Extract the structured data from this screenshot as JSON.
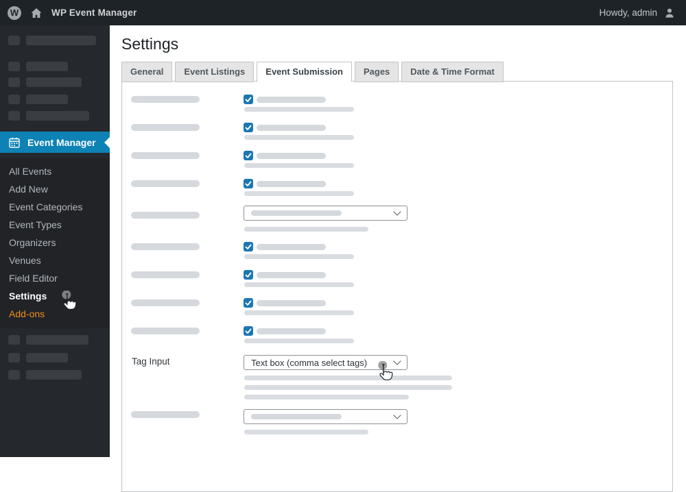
{
  "admin_bar": {
    "site_name": "WP Event Manager",
    "user_greeting": "Howdy, admin"
  },
  "sidebar": {
    "active_menu": {
      "label": "Event Manager"
    },
    "submenu": [
      {
        "label": "All Events",
        "state": "normal"
      },
      {
        "label": "Add New",
        "state": "normal"
      },
      {
        "label": "Event Categories",
        "state": "normal"
      },
      {
        "label": "Event Types",
        "state": "normal"
      },
      {
        "label": "Organizers",
        "state": "normal"
      },
      {
        "label": "Venues",
        "state": "normal"
      },
      {
        "label": "Field Editor",
        "state": "normal"
      },
      {
        "label": "Settings",
        "state": "current"
      },
      {
        "label": "Add-ons",
        "state": "orange"
      }
    ]
  },
  "main": {
    "title": "Settings",
    "tabs": [
      {
        "label": "General",
        "active": false
      },
      {
        "label": "Event Listings",
        "active": false
      },
      {
        "label": "Event Submission",
        "active": true
      },
      {
        "label": "Pages",
        "active": false
      },
      {
        "label": "Date & Time Format",
        "active": false
      }
    ],
    "form": {
      "checked_checkbox_count": 8,
      "tag_input": {
        "label": "Tag Input",
        "value": "Text box (comma select tags)"
      }
    }
  },
  "icons": {
    "check": "checkmark",
    "chevron_down": "chevron-down",
    "calendar": "calendar",
    "wordpress_logo": "W",
    "home": "home",
    "user": "person"
  },
  "colors": {
    "admin_bar_bg": "#1d2327",
    "sidebar_bg": "#25282c",
    "menu_highlight_blue": "#0e82b4",
    "checkbox_blue": "#1b77b4",
    "addons_orange": "#ef8e1b",
    "skeleton_gray": "#d5d9dd",
    "border_gray": "#c3c4c7"
  }
}
